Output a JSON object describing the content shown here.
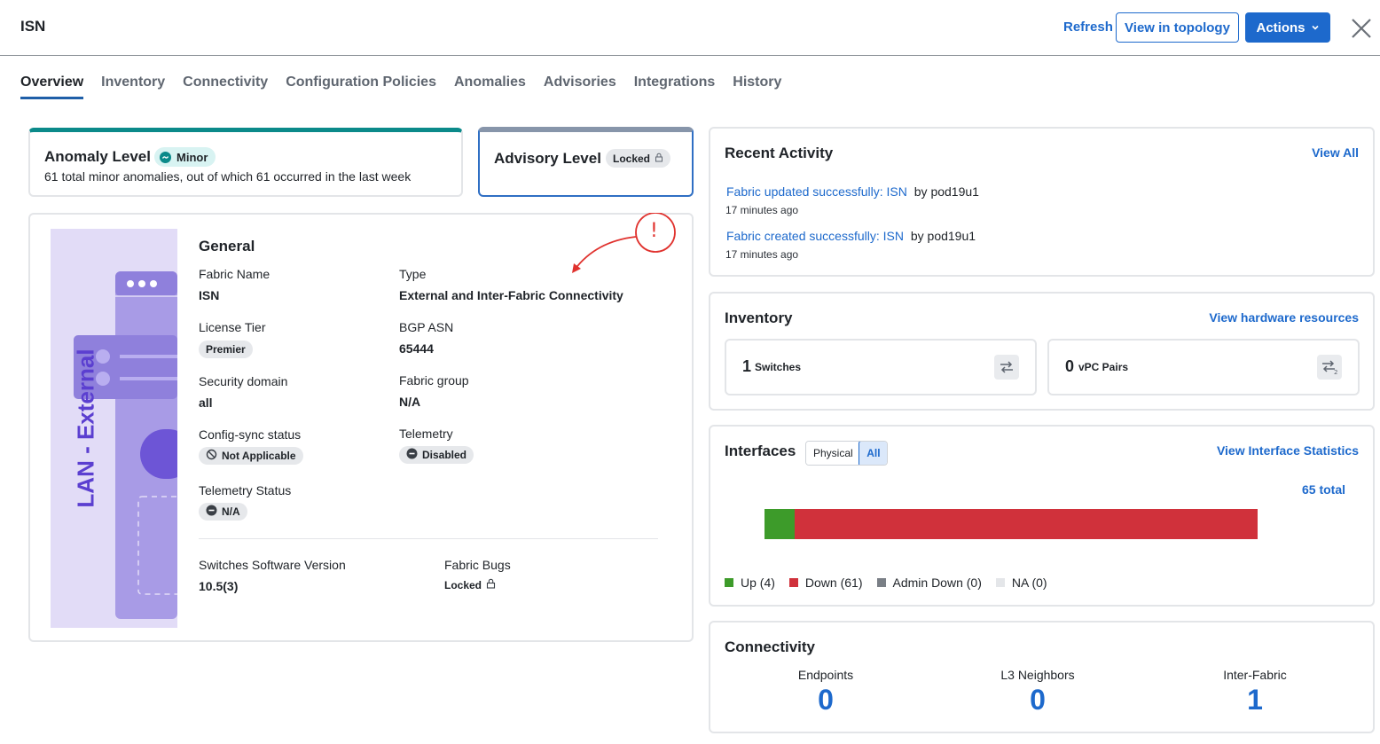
{
  "header": {
    "title": "ISN",
    "refresh_label": "Refresh",
    "topology_label": "View in topology",
    "actions_label": "Actions"
  },
  "tabs": [
    {
      "label": "Overview",
      "active": true
    },
    {
      "label": "Inventory"
    },
    {
      "label": "Connectivity"
    },
    {
      "label": "Configuration Policies"
    },
    {
      "label": "Anomalies"
    },
    {
      "label": "Advisories"
    },
    {
      "label": "Integrations"
    },
    {
      "label": "History"
    }
  ],
  "anomaly": {
    "label": "Anomaly Level",
    "badge": "Minor",
    "description": "61 total minor anomalies, out of which 61 occurred in the last week"
  },
  "advisory": {
    "label": "Advisory Level",
    "badge": "Locked"
  },
  "general": {
    "illustration_text": "LAN - External",
    "title": "General",
    "fabric_name_label": "Fabric Name",
    "fabric_name": "ISN",
    "type_label": "Type",
    "type": "External and Inter-Fabric Connectivity",
    "license_tier_label": "License Tier",
    "license_tier": "Premier",
    "bgp_asn_label": "BGP ASN",
    "bgp_asn": "65444",
    "security_domain_label": "Security domain",
    "security_domain": "all",
    "fabric_group_label": "Fabric group",
    "fabric_group": "N/A",
    "config_sync_label": "Config-sync status",
    "config_sync": "Not Applicable",
    "telemetry_label": "Telemetry",
    "telemetry": "Disabled",
    "telemetry_status_label": "Telemetry Status",
    "telemetry_status": "N/A",
    "software_version_label": "Switches Software Version",
    "software_version": "10.5(3)",
    "fabric_bugs_label": "Fabric Bugs",
    "fabric_bugs": "Locked",
    "annotation_mark": "!"
  },
  "recent_activity": {
    "title": "Recent Activity",
    "view_all": "View All",
    "items": [
      {
        "link": "Fabric updated successfully: ISN",
        "by": "by pod19u1",
        "time": "17 minutes ago"
      },
      {
        "link": "Fabric created successfully: ISN",
        "by": "by pod19u1",
        "time": "17 minutes ago"
      }
    ]
  },
  "inventory": {
    "title": "Inventory",
    "link": "View hardware resources",
    "switches_count": "1",
    "switches_label": "Switches",
    "vpc_count": "0",
    "vpc_label": "vPC Pairs"
  },
  "interfaces": {
    "title": "Interfaces",
    "toggle_physical": "Physical",
    "toggle_all": "All",
    "link": "View Interface Statistics",
    "total": "65 total",
    "colors": {
      "up": "#3d9b2a",
      "down": "#d0313b",
      "admin_down": "#7a7f86",
      "na": "#e4e6e9"
    }
  },
  "chart_data": {
    "type": "bar",
    "categories": [
      "Up",
      "Down",
      "Admin Down",
      "NA"
    ],
    "values": [
      4,
      61,
      0,
      0
    ],
    "legend": [
      "Up (4)",
      "Down (61)",
      "Admin Down (0)",
      "NA (0)"
    ],
    "total": 65
  },
  "connectivity": {
    "title": "Connectivity",
    "endpoints_label": "Endpoints",
    "endpoints": "0",
    "l3_label": "L3 Neighbors",
    "l3": "0",
    "inter_fabric_label": "Inter-Fabric",
    "inter_fabric": "1"
  }
}
